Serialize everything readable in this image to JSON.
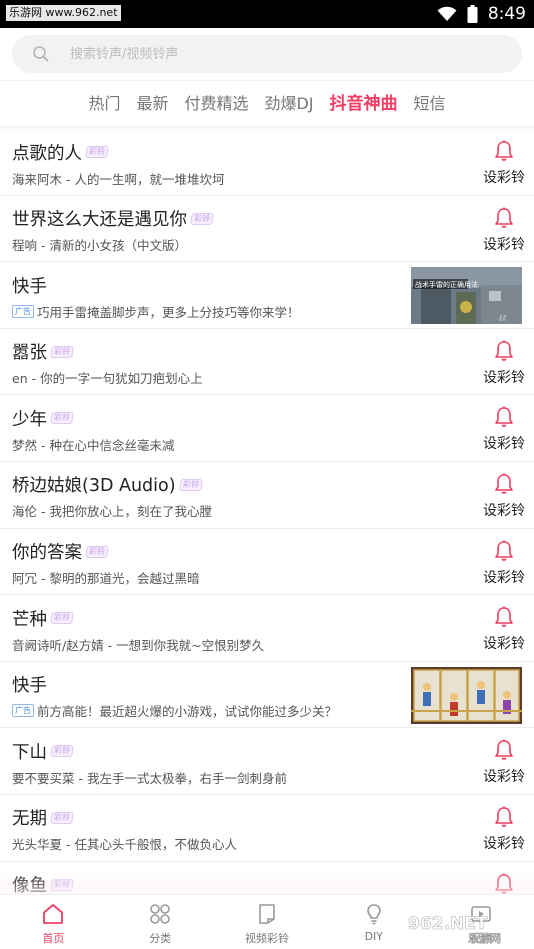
{
  "statusbar": {
    "watermark_text": "乐游网 www.962.net",
    "time": "8:49"
  },
  "search": {
    "placeholder": "搜索铃声/视频铃声"
  },
  "tabs": [
    {
      "label": "热门",
      "active": false
    },
    {
      "label": "最新",
      "active": false
    },
    {
      "label": "付费精选",
      "active": false
    },
    {
      "label": "劲爆DJ",
      "active": false
    },
    {
      "label": "抖音神曲",
      "active": true
    },
    {
      "label": "短信",
      "active": false
    }
  ],
  "tag_label": "彩铃",
  "ad_label": "广告",
  "ring_label": "设彩铃",
  "songs": [
    {
      "title": "点歌的人",
      "subtitle": "海来阿木 - 人的一生啊，就一堆堆坎坷",
      "type": "song"
    },
    {
      "title": "世界这么大还是遇见你",
      "subtitle": "程响 - 清新的小女孩（中文版）",
      "type": "song"
    },
    {
      "title": "快手",
      "subtitle": "巧用手雷掩盖脚步声，更多上分技巧等你来学！",
      "type": "ad"
    },
    {
      "title": "嚣张",
      "subtitle": "en - 你的一字一句犹如刀疤划心上",
      "type": "song"
    },
    {
      "title": "少年",
      "subtitle": "梦然 - 种在心中信念丝毫未减",
      "type": "song"
    },
    {
      "title": "桥边姑娘(3D Audio)",
      "subtitle": "海伦 - 我把你放心上，刻在了我心膛",
      "type": "song"
    },
    {
      "title": "你的答案",
      "subtitle": "阿冗 - 黎明的那道光，会越过黑暗",
      "type": "song"
    },
    {
      "title": "芒种",
      "subtitle": "音阙诗听/赵方婧 - 一想到你我就~空恨别梦久",
      "type": "song"
    },
    {
      "title": "快手",
      "subtitle": "前方高能！最近超火爆的小游戏，试试你能过多少关？",
      "type": "ad"
    },
    {
      "title": "下山",
      "subtitle": "要不要买菜 - 我左手一式太极拳，右手一剑刺身前",
      "type": "song"
    },
    {
      "title": "无期",
      "subtitle": "光头华夏 - 任其心头千般恨，不做负心人",
      "type": "song"
    },
    {
      "title": "像鱼",
      "subtitle": "",
      "type": "song"
    }
  ],
  "ad_thumb_texts": [
    "战术手雷的正确用法"
  ],
  "bottomnav": [
    {
      "label": "首页",
      "icon": "home-icon",
      "active": true
    },
    {
      "label": "分类",
      "icon": "category-icon",
      "active": false
    },
    {
      "label": "视频彩铃",
      "icon": "video-ringtone-icon",
      "active": false
    },
    {
      "label": "DIY",
      "icon": "diy-icon",
      "active": false
    },
    {
      "label": "视频",
      "icon": "video-icon",
      "active": false
    }
  ],
  "watermark": {
    "brand": "962.NET",
    "sub": "乐游网"
  },
  "colors": {
    "accent": "#f03f63",
    "tag": "#c5a0e8",
    "ad": "#4a8fd8"
  }
}
